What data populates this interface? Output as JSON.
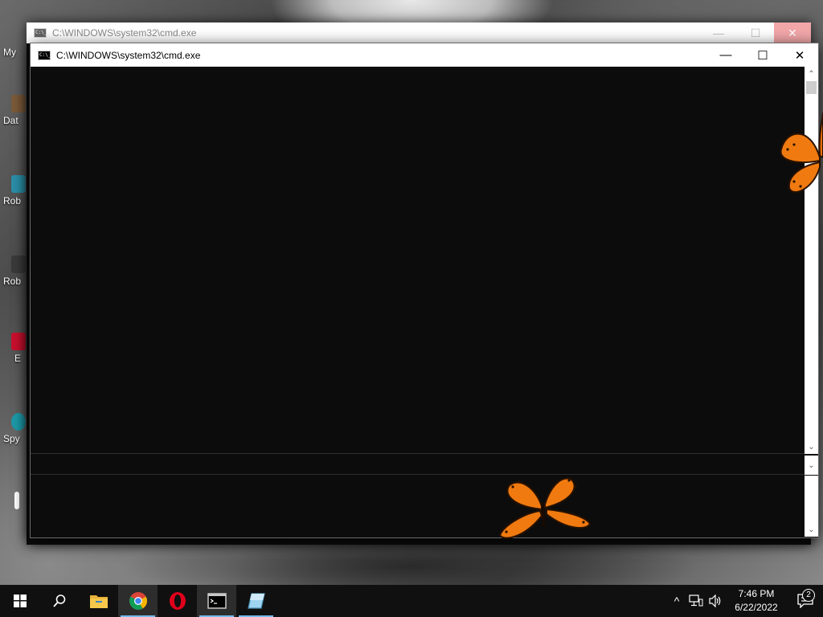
{
  "desktop": {
    "icons": [
      {
        "label": "My"
      },
      {
        "label": "Dat"
      },
      {
        "label": "Rob"
      },
      {
        "label": "Rob"
      },
      {
        "label": "E"
      },
      {
        "label": "Spy"
      }
    ]
  },
  "background_window": {
    "title": "C:\\WINDOWS\\system32\\cmd.exe",
    "controls": {
      "minimize": "—",
      "maximize": "☐",
      "close": "✕"
    }
  },
  "window": {
    "title": "C:\\WINDOWS\\system32\\cmd.exe",
    "controls": {
      "minimize": "—",
      "maximize": "☐",
      "close": "✕"
    },
    "icon": "cmd-icon",
    "icon_text": "C:\\_",
    "scroll": {
      "up": "⌃",
      "down": "⌄"
    }
  },
  "taskbar": {
    "apps": [
      {
        "name": "start-icon"
      },
      {
        "name": "search-icon"
      },
      {
        "name": "file-explorer-icon"
      },
      {
        "name": "chrome-icon"
      },
      {
        "name": "opera-icon"
      },
      {
        "name": "cmd-icon"
      },
      {
        "name": "app-icon"
      }
    ],
    "tray": {
      "chevron": "^",
      "network": "network-icon",
      "volume": "volume-icon"
    },
    "clock": {
      "time": "7:46 PM",
      "date": "6/22/2022"
    },
    "notifications": {
      "count": "2"
    }
  },
  "colors": {
    "console_bg": "#0c0c0c",
    "taskbar_bg": "#101010",
    "accent": "#76b9ed",
    "butterfly": "#f07a10"
  }
}
